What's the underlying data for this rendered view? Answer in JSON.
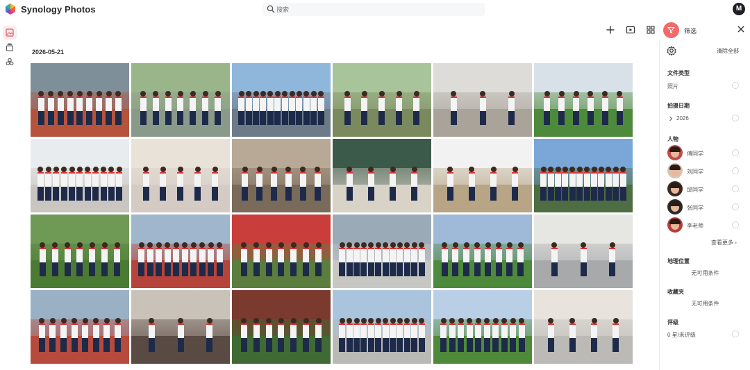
{
  "app": {
    "title": "Synology Photos"
  },
  "search": {
    "placeholder": "搜索"
  },
  "user": {
    "initial": "M"
  },
  "rail": {
    "items": [
      {
        "icon": "photos-icon",
        "active": true
      },
      {
        "icon": "albums-icon",
        "active": false
      },
      {
        "icon": "sharing-icon",
        "active": false
      }
    ]
  },
  "toolbar": {
    "tools": [
      "add-icon",
      "slideshow-icon",
      "grid-view-icon"
    ],
    "filter_label": "筛选"
  },
  "timeline": {
    "date": "2026-05-21"
  },
  "photos": [
    {
      "sky": "#7f8f99",
      "ground": "#b5533d",
      "people": 9
    },
    {
      "sky": "#9bb58a",
      "ground": "#8a9a8a",
      "people": 7
    },
    {
      "sky": "#8fb6db",
      "ground": "#6d7a88",
      "people": 12
    },
    {
      "sky": "#a8c49a",
      "ground": "#7b8a5e",
      "people": 5
    },
    {
      "sky": "#dedcd8",
      "ground": "#a9a39a",
      "people": 3
    },
    {
      "sky": "#d9e1e8",
      "ground": "#4e8a3c",
      "people": 6
    },
    {
      "sky": "#e9ecef",
      "ground": "#c9c6c2",
      "people": 11
    },
    {
      "sky": "#e8e2d9",
      "ground": "#d4ccc4",
      "people": 5
    },
    {
      "sky": "#b8a996",
      "ground": "#7a6a5a",
      "people": 6
    },
    {
      "sky": "#3c5a4a",
      "ground": "#d9d2c7",
      "people": 4
    },
    {
      "sky": "#f2f2f2",
      "ground": "#b8a586",
      "people": 4
    },
    {
      "sky": "#7aa7d8",
      "ground": "#4f6d42",
      "people": 12
    },
    {
      "sky": "#6f9a56",
      "ground": "#4b7a32",
      "people": 7
    },
    {
      "sky": "#9fb6cc",
      "ground": "#b6443a",
      "people": 10
    },
    {
      "sky": "#c93e3a",
      "ground": "#5b7d3e",
      "people": 7
    },
    {
      "sky": "#9aaab7",
      "ground": "#c6c6c3",
      "people": 12
    },
    {
      "sky": "#9fb9d9",
      "ground": "#4e8a3c",
      "people": 8
    },
    {
      "sky": "#e6e6e3",
      "ground": "#a7a9ab",
      "people": 3
    },
    {
      "sky": "#9ab0c4",
      "ground": "#b64a3c",
      "people": 8
    },
    {
      "sky": "#c9c2b8",
      "ground": "#5a4a44",
      "people": 3
    },
    {
      "sky": "#7a3a2e",
      "ground": "#3f6a33",
      "people": 7
    },
    {
      "sky": "#a9c4dc",
      "ground": "#b9b9b6",
      "people": 12
    },
    {
      "sky": "#b8cfe6",
      "ground": "#4f8a3a",
      "people": 10
    },
    {
      "sky": "#e8e4dd",
      "ground": "#bcbab6",
      "people": 4
    }
  ],
  "filter_panel": {
    "clear_all": "清除全部",
    "file_type": {
      "title": "文件类型",
      "option": "照片"
    },
    "date_taken": {
      "title": "拍摄日期",
      "option": "2026"
    },
    "people": {
      "title": "人物",
      "items": [
        "傅同学",
        "刘同学",
        "邱同学",
        "张同学",
        "李老师"
      ],
      "see_more": "查看更多"
    },
    "location": {
      "title": "地理位置",
      "empty": "无可用条件"
    },
    "favorites": {
      "title": "收藏夹",
      "empty": "无可用条件"
    },
    "rating": {
      "title": "评级",
      "option": "0 星/未评级"
    }
  },
  "colors": {
    "accent": "#f26a6a",
    "rail_active_bg": "#fdecec"
  }
}
